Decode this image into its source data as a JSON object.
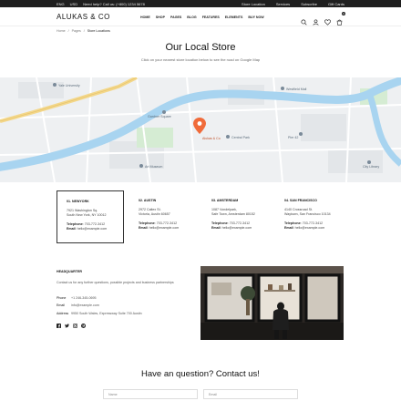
{
  "topbar": {
    "language": "ENG",
    "currency": "USD",
    "help": "Need help? Call us: (+800) 1234 5678",
    "links": [
      "Store Location",
      "Services",
      "Subscribe",
      "Gift Cards"
    ]
  },
  "header": {
    "logo": "ALUKAS & CO",
    "nav": [
      "HOME",
      "SHOP",
      "PAGES",
      "BLOG",
      "FEATURES",
      "ELEMENTS",
      "BUY NOW"
    ],
    "cart_count": "0"
  },
  "breadcrumb": [
    "Home",
    "Pages",
    "Store Locations"
  ],
  "page": {
    "title": "Our Local Store",
    "subtitle": "Click on your nearest store location below to see the road on Google Map"
  },
  "stores": [
    {
      "title": "01. NEWYORK",
      "addr1": "7921 Washington Sq.",
      "addr2": "South New York, NY 10012",
      "phone_label": "Telephone",
      "phone": "703-772-3412",
      "email_label": "Email",
      "email": "hello@example.com",
      "active": true
    },
    {
      "title": "02. AUSTIN",
      "addr1": "2972 Caltex St.",
      "addr2": "Victoria, Austin 60657",
      "phone_label": "Telephone",
      "phone": "703-772-3412",
      "email_label": "Email",
      "email": "hello@example.com",
      "active": false
    },
    {
      "title": "03. AMSTERDAM",
      "addr1": "1087 Vondelpark,",
      "addr2": "Safe Town, Amsterdam 80152",
      "phone_label": "Telephone",
      "phone": "703-772-3412",
      "email_label": "Email",
      "email": "hello@example.com",
      "active": false
    },
    {
      "title": "04. SAN FRANCISCO",
      "addr1": "4140 Crossroad St.",
      "addr2": "Waytown, San Francisco 10134",
      "phone_label": "Telephone",
      "phone": "703-772-3412",
      "email_label": "Email",
      "email": "hello@example.com",
      "active": false
    }
  ],
  "hq": {
    "title": "HEADQUARTER",
    "intro": "Contact us for any further questions, possible projects and business partnerships",
    "phone_label": "Phone",
    "phone": "+1 246-345-0695",
    "email_label": "Email",
    "email": "info@example.com",
    "address_label": "Address",
    "address": "9950 South Wales, Expressway Suite 700 Austin"
  },
  "map_labels": {
    "pin": "Alukas & Co",
    "places": [
      "Yale University",
      "Westfield Mall",
      "Gardner Square",
      "Central Park",
      "Pier 42",
      "Art Museum",
      "City Library"
    ]
  },
  "contact": {
    "title": "Have an question? Contact us!",
    "name_placeholder": "Name",
    "email_placeholder": "Email"
  },
  "colors": {
    "topbar_bg": "#1f1f1f",
    "map_water": "#a8d4f0",
    "map_road": "#f3d78a",
    "pin": "#f06b3a"
  }
}
